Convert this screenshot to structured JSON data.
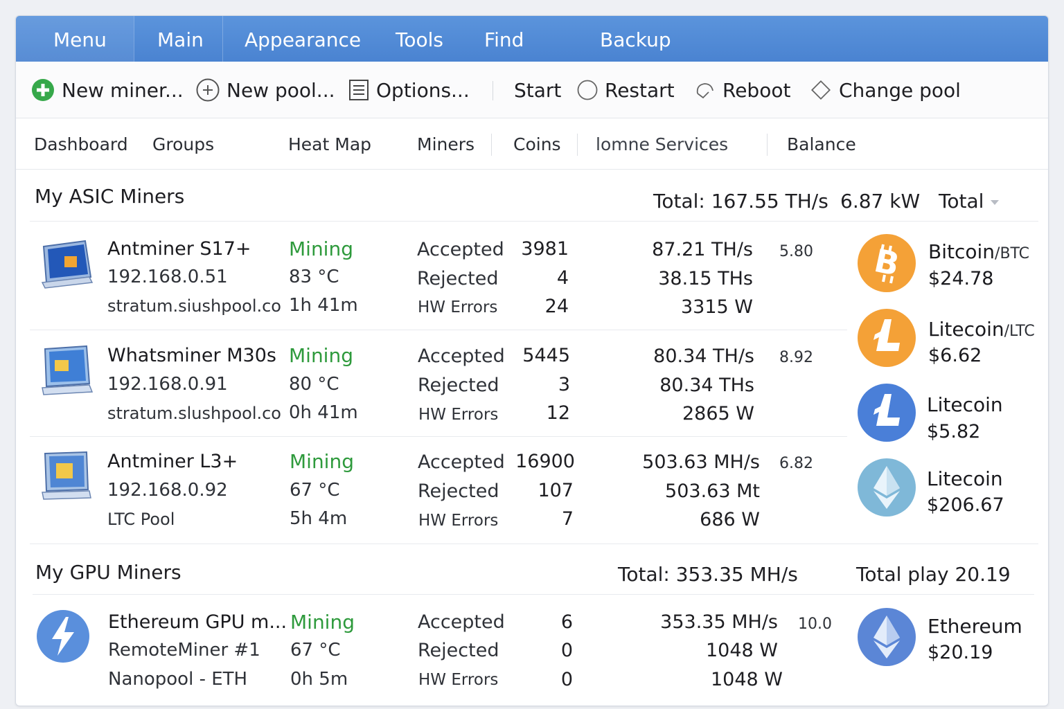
{
  "menubar": {
    "items": [
      "Menu",
      "Main",
      "Appearance",
      "Tools",
      "Find",
      "Backup"
    ]
  },
  "toolbar": {
    "new_miner": "New miner...",
    "new_pool": "New pool...",
    "options": "Options...",
    "start": "Start",
    "restart": "Restart",
    "reboot": "Reboot",
    "change_pool": "Change pool"
  },
  "nav": {
    "tabs": [
      "Dashboard",
      "Groups",
      "Heat Map",
      "Miners",
      "Coins",
      "lomne Services",
      "Balance"
    ]
  },
  "asic": {
    "title": "My ASIC Miners",
    "total_hash": "Total: 167.55 TH/s",
    "total_power": "6.87 kW",
    "total_dropdown": "Total",
    "miners": [
      {
        "name": "Antminer S17+",
        "ip": "192.168.0.51",
        "pool": "stratum.siushpool.co",
        "status": "Mining",
        "temp": "83 °C",
        "uptime": "1h 41m",
        "accepted_label": "Accepted",
        "accepted": "3981",
        "rejected_label": "Rejected",
        "rejected": "4",
        "hw_label": "HW Errors",
        "hw": "24",
        "hash1": "87.21 TH/s",
        "hash2": "38.15 THs",
        "power": "3315 W",
        "eff": "5.80"
      },
      {
        "name": "Whatsminer M30s",
        "ip": "192.168.0.91",
        "pool": "stratum.slushpool.co",
        "status": "Mining",
        "temp": "80 °C",
        "uptime": "0h 41m",
        "accepted_label": "Accepted",
        "accepted": "5445",
        "rejected_label": "Rejected",
        "rejected": "3",
        "hw_label": "HW Errors",
        "hw": "12",
        "hash1": "80.34 TH/s",
        "hash2": "80.34 THs",
        "power": "2865 W",
        "eff": "8.92"
      },
      {
        "name": "Antminer L3+",
        "ip": "192.168.0.92",
        "pool": "LTC Pool",
        "status": "Mining",
        "temp": "67 °C",
        "uptime": "5h 4m",
        "accepted_label": "Accepted",
        "accepted": "16900",
        "rejected_label": "Rejected",
        "rejected": "107",
        "hw_label": "HW Errors",
        "hw": "7",
        "hash1": "503.63 MH/s",
        "hash2": "503.63 Mt",
        "power": "686 W",
        "eff": "6.82"
      }
    ]
  },
  "gpu": {
    "title": "My GPU Miners",
    "total_hash": "Total: 353.35 MH/s",
    "total_play": "Total play 20.19",
    "miner": {
      "name": "Ethereum GPU m...",
      "host": "RemoteMiner #1",
      "pool": "Nanopool - ETH",
      "status": "Mining",
      "temp": "67 °C",
      "uptime": "0h 5m",
      "accepted_label": "Accepted",
      "accepted": "6",
      "rejected_label": "Rejected",
      "rejected": "0",
      "hw_label": "HW Errors",
      "hw": "0",
      "hash1": "353.35 MH/s",
      "hash2": "1048 W",
      "power": "1048 W",
      "eff": "10.0"
    }
  },
  "coins": [
    {
      "name": "Bitcoin",
      "symbol": "/BTC",
      "price": "$24.78",
      "color": "#f4a137",
      "icon": "bitcoin-icon"
    },
    {
      "name": "Litecoin",
      "symbol": "/LTC",
      "price": "$6.62",
      "color": "#f4a137",
      "icon": "litecoin-icon"
    },
    {
      "name": "Litecoin",
      "symbol": "",
      "price": "$5.82",
      "color": "#4a7fd8",
      "icon": "litecoin-icon"
    },
    {
      "name": "Litecoin",
      "symbol": "",
      "price": "$206.67",
      "color": "#7fb8d8",
      "icon": "ethereum-icon"
    },
    {
      "name": "Ethereum",
      "symbol": "",
      "price": "$20.19",
      "color": "#5b86d6",
      "icon": "ethereum-icon"
    }
  ],
  "colors": {
    "menubar": "#4a83d1",
    "mining": "#2e9a3c",
    "accent": "#4a83d1"
  }
}
